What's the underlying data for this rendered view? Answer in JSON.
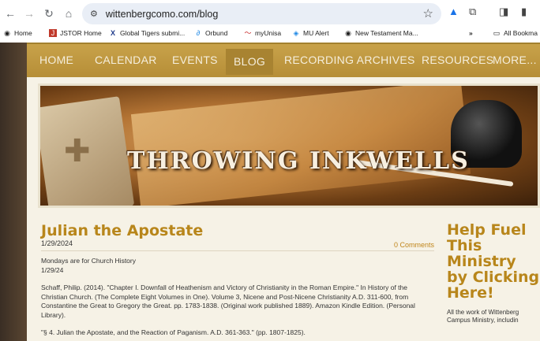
{
  "browser": {
    "url": "wittenbergcomo.com/blog",
    "icons": [
      "back-icon",
      "forward-icon",
      "reload-icon",
      "home-icon",
      "tune-icon",
      "star-icon",
      "drive-icon",
      "extensions-icon",
      "sidepanel-icon",
      "profile-icon"
    ]
  },
  "bookmarks": {
    "items": [
      {
        "label": "Home",
        "icon": "globe-icon"
      },
      {
        "label": "JSTOR Home",
        "icon": "jstor-icon"
      },
      {
        "label": "Global Tigers submi...",
        "icon": "xm-icon"
      },
      {
        "label": "Orbund",
        "icon": "orbund-icon"
      },
      {
        "label": "myUnisa",
        "icon": "unisa-icon"
      },
      {
        "label": "MU Alert",
        "icon": "alert-icon"
      },
      {
        "label": "New Testament Ma...",
        "icon": "globe-icon"
      }
    ],
    "overflow": "»",
    "all_bookmarks": "All Bookma"
  },
  "site": {
    "nav": [
      "HOME",
      "CALENDAR",
      "EVENTS",
      "BLOG",
      "RECORDING ARCHIVES",
      "RESOURCES",
      "MORE..."
    ],
    "active_nav": "BLOG",
    "banner_title": "THROWING INKWELLS"
  },
  "post": {
    "title": "Julian the Apostate",
    "date": "1/29/2024",
    "comments": "0 Comments",
    "p1_line1": "Mondays are for Church History",
    "p1_line2": "1/29/24",
    "p2": "Schaff, Philip. (2014). \"Chapter I. Downfall of Heathenism and Victory of Christianity in the Roman Empire.\" In  History of the Christian Church. (The Complete Eight Volumes in One). Volume 3, Nicene and Post-Nicene Christianity A.D. 311-600, from Constantine the Great to Gregory the Great. pp. 1783-1838. (Original work published 1889).  Amazon Kindle Edition. (Personal Library).",
    "p3": "\"§ 4. Julian the Apostate, and the Reaction of Paganism. A.D. 361-363.\" (pp. 1807-1825)."
  },
  "sidebar": {
    "title": "Help Fuel This Ministry by Clicking Here!",
    "text1": "All the work of Wittenberg",
    "text2": "Campus Ministry, includin"
  },
  "colors": {
    "nav_bg": "#c29a3f",
    "accent": "#b8861b",
    "content_bg": "#f6f2e6"
  }
}
